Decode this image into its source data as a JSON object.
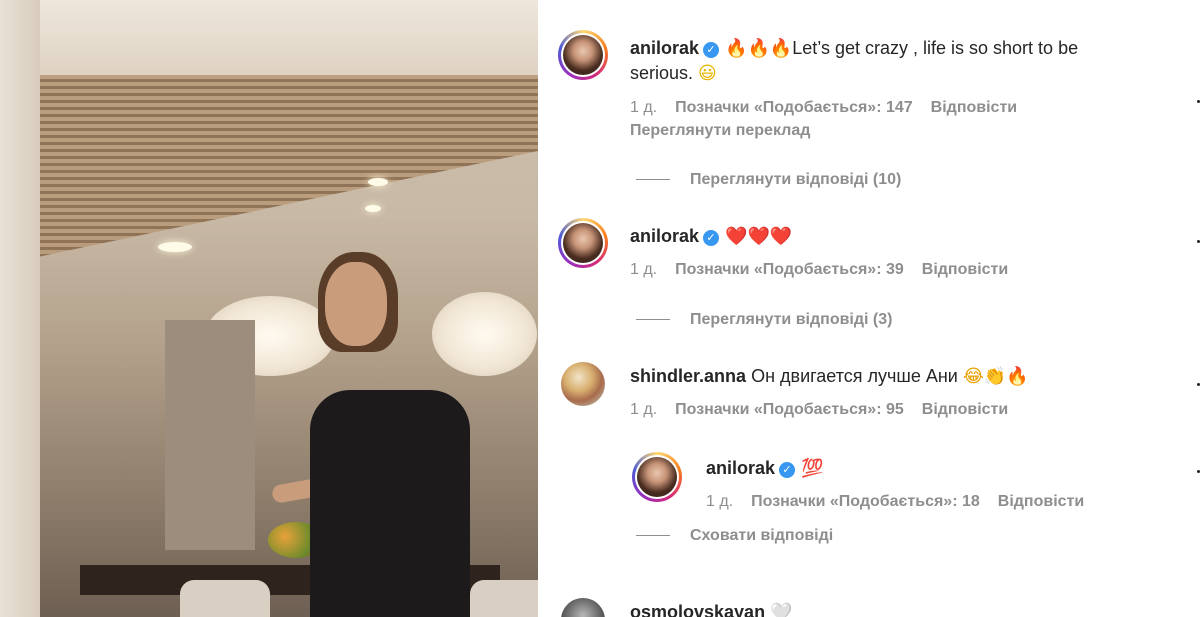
{
  "comments": [
    {
      "username": "anilorak",
      "verified": true,
      "emoji_prefix": "🔥🔥🔥",
      "text_line1": "Let’s get crazy , life is so short to be",
      "text_line2": "serious. ",
      "emoji_suffix": "😃",
      "time": "1 д.",
      "likes": "Позначки «Подобається»: 147",
      "reply": "Відповісти",
      "translate": "Переглянути переклад",
      "view_replies": "Переглянути відповіді (10)"
    },
    {
      "username": "anilorak",
      "verified": true,
      "text": "❤️❤️❤️",
      "time": "1 д.",
      "likes": "Позначки «Подобається»: 39",
      "reply": "Відповісти",
      "view_replies": "Переглянути відповіді (3)"
    },
    {
      "username": "shindler.anna",
      "verified": false,
      "text": "Он двигается лучше Ани ",
      "emoji_suffix": "😂👏🔥",
      "time": "1 д.",
      "likes": "Позначки «Подобається»: 95",
      "reply": "Відповісти",
      "nested_reply": {
        "username": "anilorak",
        "verified": true,
        "text": "💯",
        "time": "1 д.",
        "likes": "Позначки «Подобається»: 18",
        "reply": "Відповісти"
      },
      "hide_replies": "Сховати відповіді"
    },
    {
      "username": "osmolovskayan",
      "verified": false,
      "text": "🤍"
    }
  ]
}
